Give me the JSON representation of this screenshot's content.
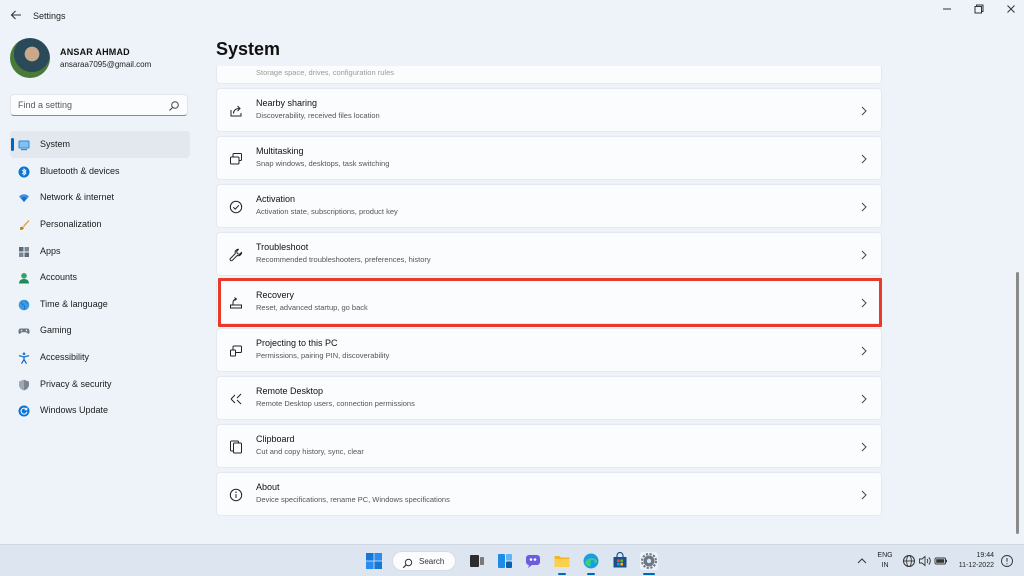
{
  "window": {
    "title": "Settings",
    "controls": [
      "minimize",
      "maximize",
      "close"
    ]
  },
  "profile": {
    "name": "ANSAR AHMAD",
    "email": "ansaraa7095@gmail.com"
  },
  "search": {
    "placeholder": "Find a setting"
  },
  "sidebar": {
    "items": [
      {
        "label": "System",
        "icon": "system-icon",
        "active": true
      },
      {
        "label": "Bluetooth & devices",
        "icon": "bluetooth-icon"
      },
      {
        "label": "Network & internet",
        "icon": "wifi-icon"
      },
      {
        "label": "Personalization",
        "icon": "brush-icon"
      },
      {
        "label": "Apps",
        "icon": "apps-icon"
      },
      {
        "label": "Accounts",
        "icon": "accounts-icon"
      },
      {
        "label": "Time & language",
        "icon": "globe-icon"
      },
      {
        "label": "Gaming",
        "icon": "gaming-icon"
      },
      {
        "label": "Accessibility",
        "icon": "accessibility-icon"
      },
      {
        "label": "Privacy & security",
        "icon": "shield-icon"
      },
      {
        "label": "Windows Update",
        "icon": "update-icon"
      }
    ]
  },
  "main": {
    "title": "System",
    "partial_subtitle": "Storage space, drives, configuration rules",
    "cards": [
      {
        "title": "Nearby sharing",
        "subtitle": "Discoverability, received files location",
        "icon": "share-icon"
      },
      {
        "title": "Multitasking",
        "subtitle": "Snap windows, desktops, task switching",
        "icon": "multitasking-icon"
      },
      {
        "title": "Activation",
        "subtitle": "Activation state, subscriptions, product key",
        "icon": "check-circle-icon"
      },
      {
        "title": "Troubleshoot",
        "subtitle": "Recommended troubleshooters, preferences, history",
        "icon": "wrench-icon"
      },
      {
        "title": "Recovery",
        "subtitle": "Reset, advanced startup, go back",
        "icon": "recovery-icon",
        "highlighted": true
      },
      {
        "title": "Projecting to this PC",
        "subtitle": "Permissions, pairing PIN, discoverability",
        "icon": "projecting-icon"
      },
      {
        "title": "Remote Desktop",
        "subtitle": "Remote Desktop users, connection permissions",
        "icon": "remote-desktop-icon"
      },
      {
        "title": "Clipboard",
        "subtitle": "Cut and copy history, sync, clear",
        "icon": "clipboard-icon"
      },
      {
        "title": "About",
        "subtitle": "Device specifications, rename PC, Windows specifications",
        "icon": "info-icon"
      }
    ]
  },
  "taskbar": {
    "search_label": "Search",
    "lang_line1": "ENG",
    "lang_line2": "IN",
    "time": "19:44",
    "date": "11-12-2022",
    "accent": "#0067c0"
  },
  "colors": {
    "accent": "#0067c0",
    "highlight_border": "#e8392a"
  }
}
